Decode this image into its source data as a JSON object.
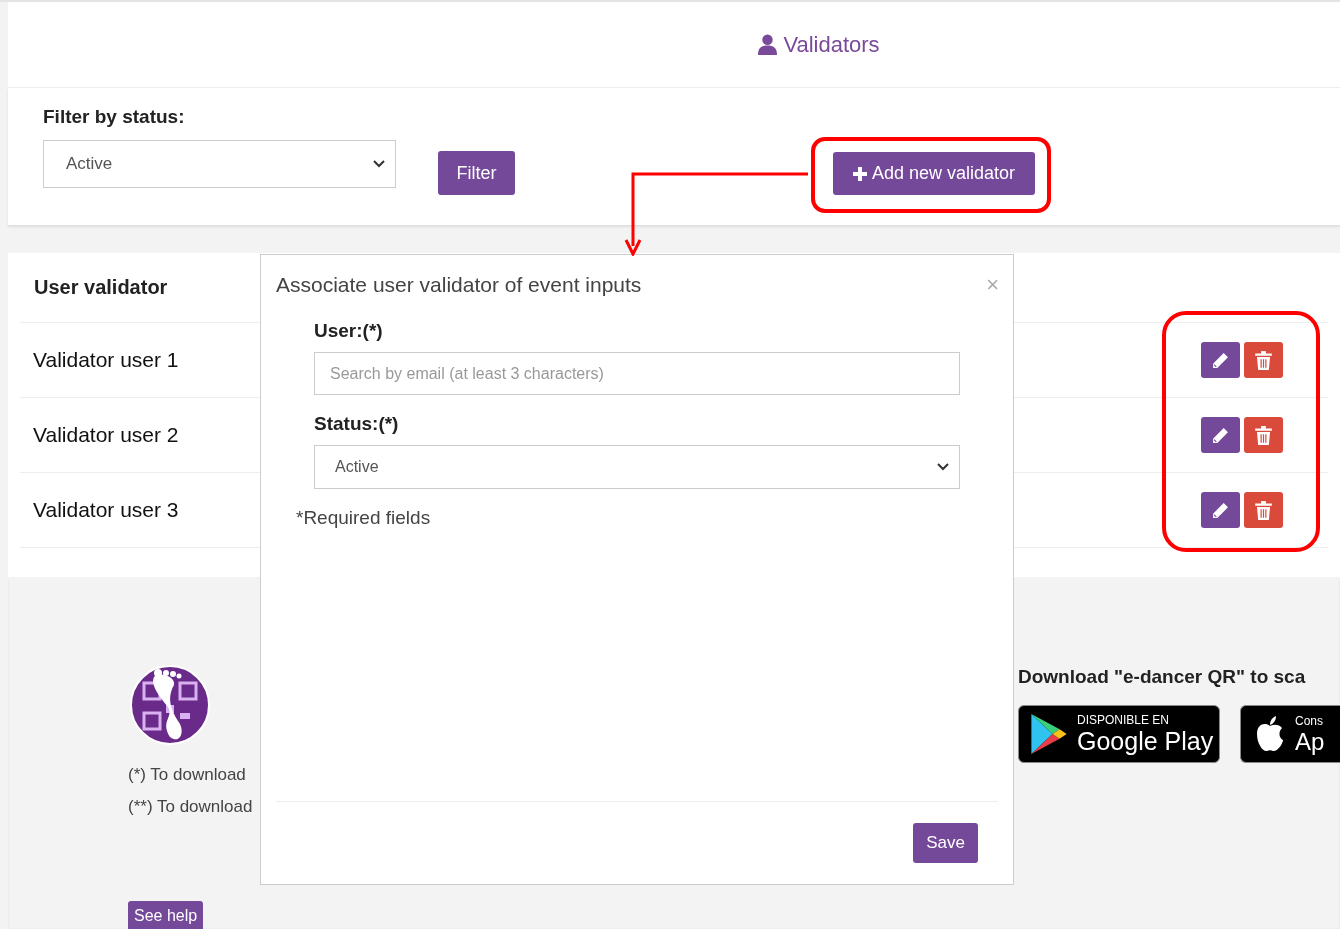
{
  "header": {
    "title": "Validators"
  },
  "filter": {
    "label": "Filter by status:",
    "select_value": "Active",
    "filter_button": "Filter",
    "add_button": "Add new validator"
  },
  "table": {
    "column_header": "User validator",
    "rows": [
      {
        "name": "Validator user 1"
      },
      {
        "name": "Validator user 2"
      },
      {
        "name": "Validator user 3"
      }
    ]
  },
  "modal": {
    "title": "Associate user validator of event inputs",
    "close": "×",
    "fields": [
      {
        "kind": "search",
        "label": "User:(*)",
        "placeholder": "Search by email (at least 3 characters)"
      },
      {
        "kind": "select",
        "label": "Status:(*)",
        "value": "Active"
      }
    ],
    "note": "*Required fields",
    "save_button": "Save"
  },
  "footer": {
    "notes": [
      "(*) To download",
      "(**) To download"
    ],
    "help_button": "See help",
    "download_heading": "Download \"e-dancer QR\" to sca",
    "store_badges": [
      {
        "kind": "google",
        "small": "DISPONIBLE EN",
        "big": "Google Play"
      },
      {
        "kind": "apple",
        "small": "Cons",
        "big": "Ap"
      }
    ]
  }
}
